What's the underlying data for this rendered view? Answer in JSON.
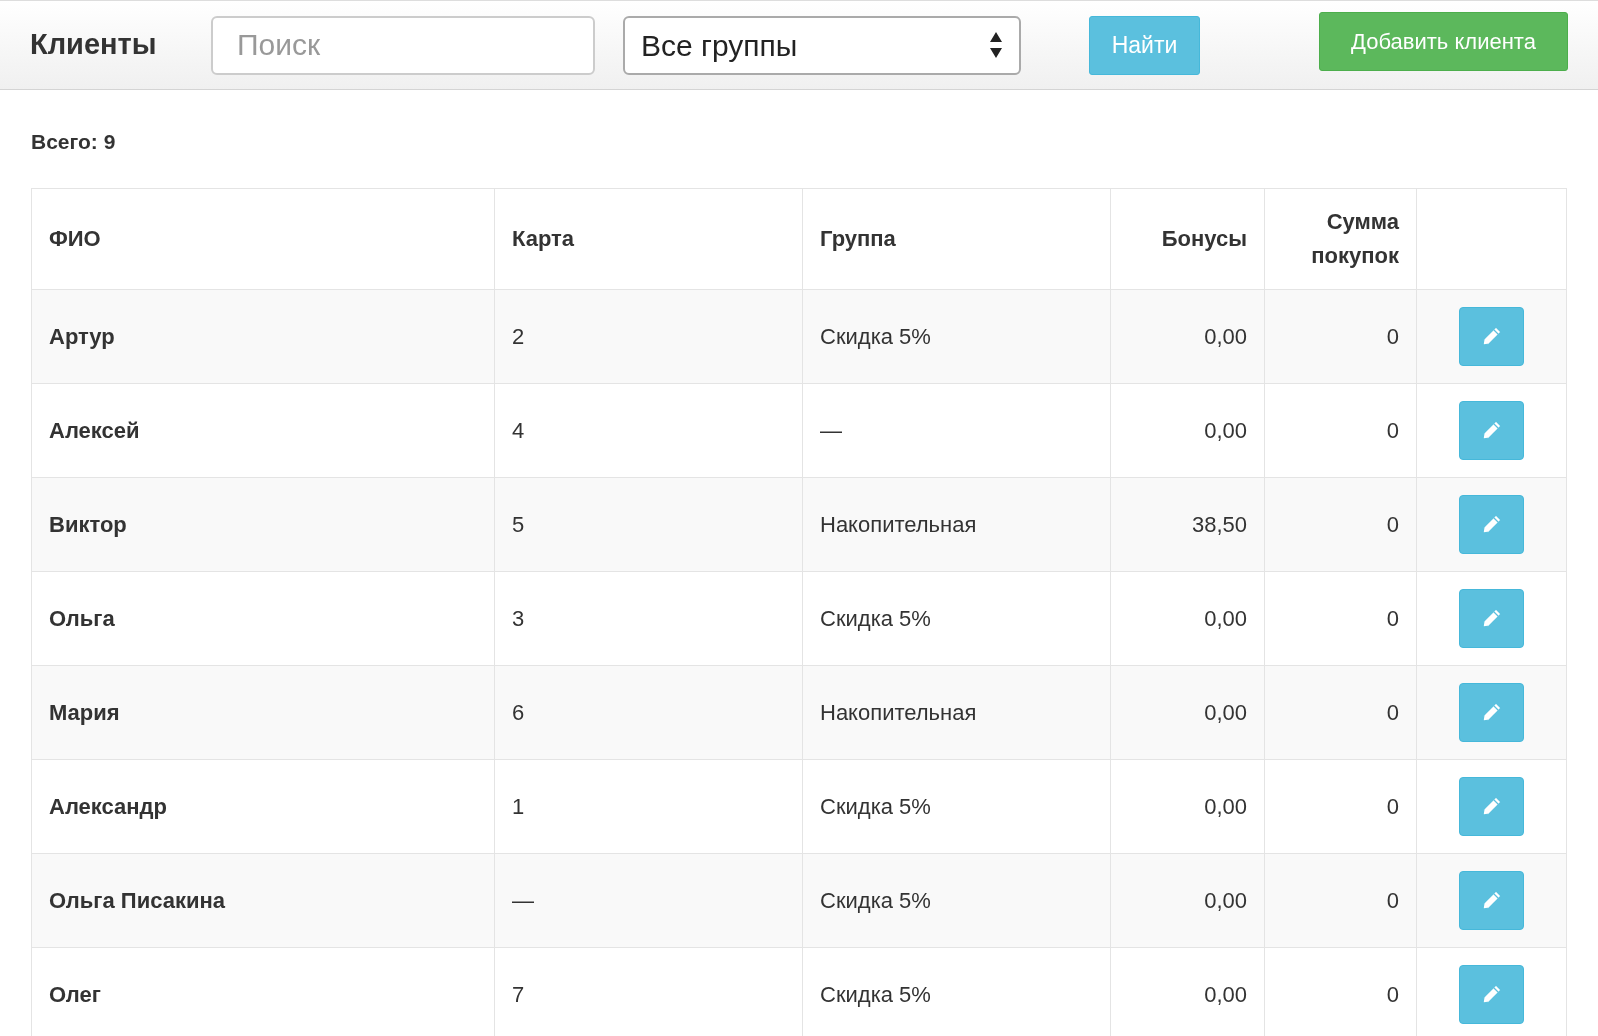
{
  "header": {
    "title": "Клиенты",
    "search": {
      "placeholder": "Поиск"
    },
    "group_select": {
      "value": "Все группы"
    },
    "find_button": "Найти",
    "add_button": "Добавить клиента"
  },
  "total": "Всего: 9",
  "table": {
    "columns": [
      "ФИО",
      "Карта",
      "Группа",
      "Бонусы",
      "Сумма покупок"
    ],
    "rows": [
      {
        "name": "Артур",
        "card": "2",
        "group": "Скидка 5%",
        "bonuses": "0,00",
        "purchases": "0"
      },
      {
        "name": "Алексей",
        "card": "4",
        "group": "—",
        "bonuses": "0,00",
        "purchases": "0"
      },
      {
        "name": "Виктор",
        "card": "5",
        "group": "Накопительная",
        "bonuses": "38,50",
        "purchases": "0"
      },
      {
        "name": "Ольга",
        "card": "3",
        "group": "Скидка 5%",
        "bonuses": "0,00",
        "purchases": "0"
      },
      {
        "name": "Мария",
        "card": "6",
        "group": "Накопительная",
        "bonuses": "0,00",
        "purchases": "0"
      },
      {
        "name": "Александр",
        "card": "1",
        "group": "Скидка 5%",
        "bonuses": "0,00",
        "purchases": "0"
      },
      {
        "name": "Ольга Писакина",
        "card": "—",
        "group": "Скидка 5%",
        "bonuses": "0,00",
        "purchases": "0"
      },
      {
        "name": "Олег",
        "card": "7",
        "group": "Скидка 5%",
        "bonuses": "0,00",
        "purchases": "0"
      }
    ]
  }
}
